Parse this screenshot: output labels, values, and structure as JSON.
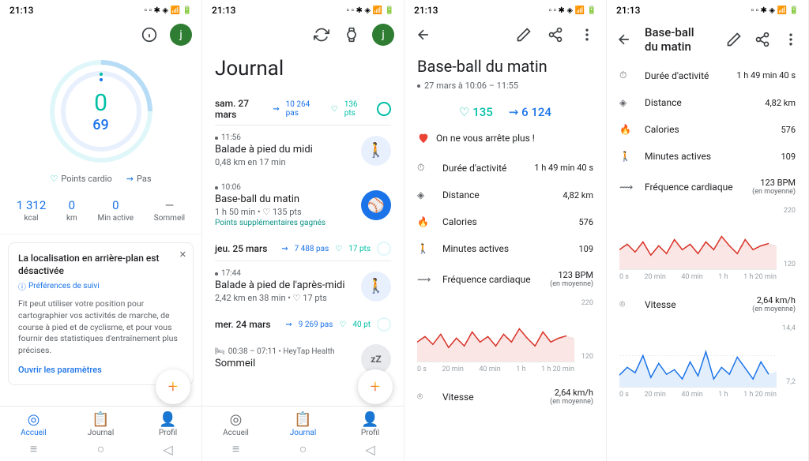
{
  "status": {
    "time": "21:13"
  },
  "home": {
    "ring": {
      "cardio": "0",
      "steps": "69"
    },
    "legend": {
      "cardio": "Points cardio",
      "steps": "Pas"
    },
    "stats": [
      {
        "value": "1 312",
        "label": "kcal"
      },
      {
        "value": "0",
        "label": "km"
      },
      {
        "value": "0",
        "label": "Min active"
      },
      {
        "value": "—",
        "label": "Sommeil"
      }
    ],
    "card": {
      "title": "La localisation en arrière-plan est désactivée",
      "pref": "Préférences de suivi",
      "body": "Fit peut utiliser votre position pour cartographier vos activités de marche, de course à pied et de cyclisme, et pour vous fournir des statistiques d'entraînement plus précises.",
      "link": "Ouvrir les paramètres"
    },
    "nav": {
      "home": "Accueil",
      "journal": "Journal",
      "profile": "Profil"
    }
  },
  "journal": {
    "title": "Journal",
    "days": [
      {
        "name": "sam. 27 mars",
        "steps": "10 264 pas",
        "pts": "136 pts",
        "activities": [
          {
            "time": "11:56",
            "title": "Balade à pied du midi",
            "sub": "0,48 km en 17 min",
            "icon": "walk"
          },
          {
            "time": "10:06",
            "title": "Base-ball du matin",
            "sub": "1 h 50 min • ♡ 135 pts",
            "bonus": "Points supplémentaires gagnés",
            "icon": "ball"
          }
        ]
      },
      {
        "name": "jeu. 25 mars",
        "steps": "7 488 pas",
        "pts": "17 pts",
        "activities": [
          {
            "time": "17:44",
            "title": "Balade à pied de l'après-midi",
            "sub": "2,42 km en 38 min • ♡ 17 pts",
            "icon": "walk"
          }
        ]
      },
      {
        "name": "mer. 24 mars",
        "steps": "9 269 pas",
        "pts": "40 pt",
        "activities": [
          {
            "time": "00:38 – 07:11 • HeyTap Health",
            "title": "Sommeil",
            "icon": "sleep"
          }
        ]
      }
    ]
  },
  "detail": {
    "title": "Base-ball du matin",
    "datetime": "27 mars à 10:06 – 11:55",
    "summary": {
      "cardio": "135",
      "steps": "6 124"
    },
    "encourage": "On ne vous arrête plus !",
    "metrics": {
      "duration": {
        "label": "Durée d'activité",
        "value": "1 h 49 min 40 s"
      },
      "distance": {
        "label": "Distance",
        "value": "4,82 km"
      },
      "calories": {
        "label": "Calories",
        "value": "576"
      },
      "active_min": {
        "label": "Minutes actives",
        "value": "109"
      },
      "heart_rate": {
        "label": "Fréquence cardiaque",
        "value": "123 BPM",
        "sub": "(en moyenne)"
      },
      "speed": {
        "label": "Vitesse",
        "value": "2,64 km/h",
        "sub": "(en moyenne)"
      }
    }
  },
  "chart_data": [
    {
      "type": "line",
      "name": "heart_rate",
      "x_ticks": [
        "0 s",
        "20 min",
        "40 min",
        "1 h",
        "1 h 20 min"
      ],
      "y_ticks": [
        120,
        220
      ],
      "ylim": [
        60,
        220
      ],
      "values": [
        118,
        125,
        115,
        130,
        110,
        128,
        112,
        135,
        120,
        130,
        115,
        132,
        118,
        140,
        125,
        115,
        135,
        120,
        125,
        130
      ]
    },
    {
      "type": "line",
      "name": "speed",
      "x_ticks": [
        "0 s",
        "20 min",
        "40 min",
        "1 h",
        "1 h 20 min"
      ],
      "y_ticks": [
        7.2,
        14.4
      ],
      "ylim": [
        0,
        14.4
      ],
      "values": [
        3,
        5,
        4,
        7,
        3,
        6,
        4,
        5,
        3,
        6,
        4,
        8,
        3,
        5,
        4,
        7,
        5,
        3,
        6,
        4
      ]
    }
  ]
}
